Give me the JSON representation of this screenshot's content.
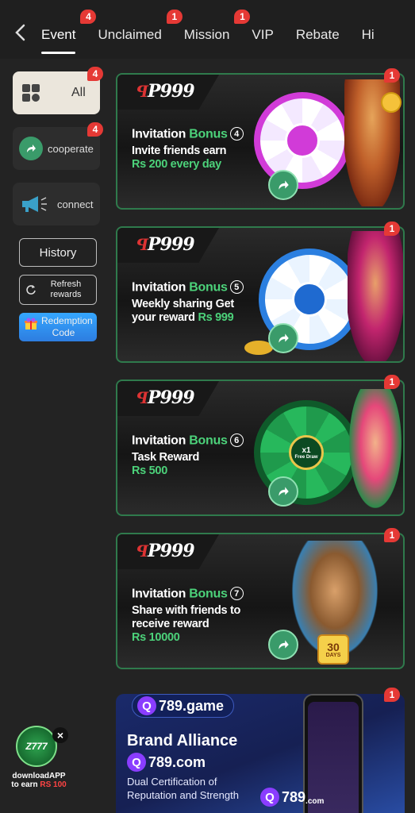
{
  "header": {
    "tabs": [
      {
        "label": "Event",
        "badge": "4",
        "active": true
      },
      {
        "label": "Unclaimed",
        "badge": "1"
      },
      {
        "label": "Mission",
        "badge": "1"
      },
      {
        "label": "VIP"
      },
      {
        "label": "Rebate"
      },
      {
        "label": "Hi"
      }
    ]
  },
  "sidebar": {
    "items": [
      {
        "label": "All",
        "badge": "4"
      },
      {
        "label": "cooperate",
        "badge": "4"
      },
      {
        "label": "connect"
      }
    ],
    "history_label": "History",
    "refresh_label": "Refresh rewards",
    "redeem_label": "Redemption Code"
  },
  "cards": [
    {
      "logo": "P999",
      "title_a": "Invitation ",
      "title_b": "Bonus",
      "num": "4",
      "line1": "Invite friends earn",
      "line2": "Rs 200 every day",
      "badge": "1"
    },
    {
      "logo": "P999",
      "title_a": "Invitation ",
      "title_b": "Bonus",
      "num": "5",
      "line1": "Weekly sharing Get",
      "line2a": "your reward ",
      "line2b": "Rs 999",
      "badge": "1"
    },
    {
      "logo": "P999",
      "title_a": "Invitation ",
      "title_b": "Bonus",
      "num": "6",
      "line1": "Task Reward",
      "line2": "Rs 500",
      "badge": "1",
      "wheel_center": "x1",
      "wheel_sub": "Free Draw"
    },
    {
      "logo": "P999",
      "title_a": "Invitation ",
      "title_b": "Bonus",
      "num": "7",
      "line1": "Share with friends to",
      "line2": "receive reward",
      "line3": "Rs 10000",
      "badge": "1",
      "days_num": "30",
      "days_lbl": "DAYS"
    }
  ],
  "brand": {
    "pill": "789.game",
    "title": "Brand Alliance",
    "logo2": "789.com",
    "desc1": "Dual Certification of",
    "desc2": "Reputation and Strength",
    "badge": "1",
    "corner_logo": "789",
    "corner_sub": ".com"
  },
  "download": {
    "app_logo": "Z777",
    "line1": "downloadAPP",
    "line2a": "to earn ",
    "line2b": "RS 100"
  },
  "colors": {
    "accent_green": "#4cd27a",
    "badge_red": "#e53935",
    "card_border": "#2f7a4c",
    "redeem_blue": "#2d7de0"
  }
}
